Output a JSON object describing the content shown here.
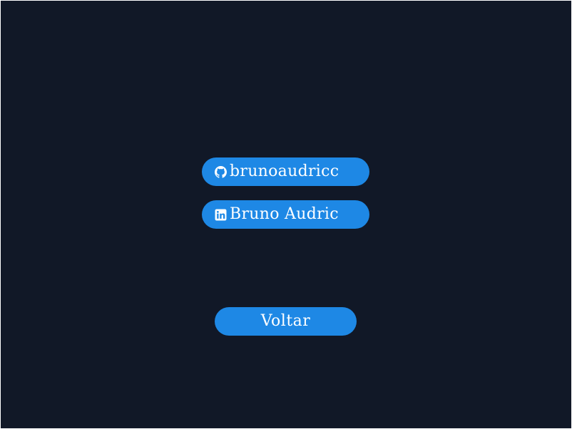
{
  "colors": {
    "background": "#111827",
    "button": "#1e88e5",
    "text": "#ffffff"
  },
  "links": {
    "github": {
      "icon": "github-icon",
      "label": "brunoaudricc"
    },
    "linkedin": {
      "icon": "linkedin-icon",
      "label": "Bruno Audric"
    }
  },
  "back_button": {
    "label": "Voltar"
  }
}
